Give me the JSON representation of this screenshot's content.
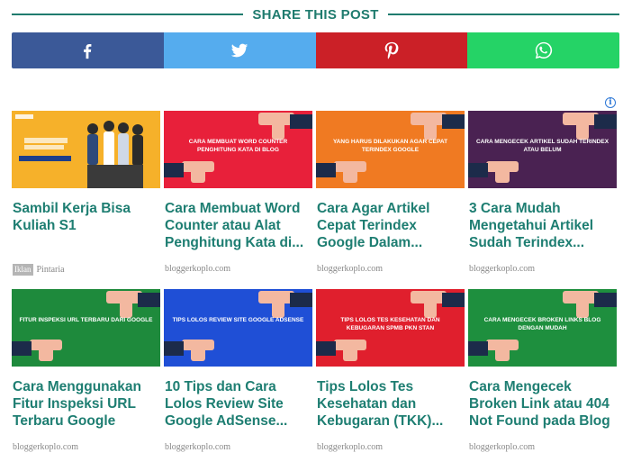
{
  "share": {
    "title": "SHARE THIS POST",
    "buttons": [
      {
        "name": "facebook",
        "icon": "facebook-icon",
        "color": "#3b5998"
      },
      {
        "name": "twitter",
        "icon": "twitter-icon",
        "color": "#55acee"
      },
      {
        "name": "pinterest",
        "icon": "pinterest-icon",
        "color": "#cb2027"
      },
      {
        "name": "whatsapp",
        "icon": "whatsapp-icon",
        "color": "#25d366"
      }
    ]
  },
  "ad_info_icon": "info-icon",
  "cards": [
    {
      "title": "Sambil Kerja Bisa Kuliah S1",
      "source": "Pintaria",
      "ad_label": "Iklan",
      "thumb_bg": "#f3a51f",
      "thumb_text": ""
    },
    {
      "title": "Cara Membuat Word Counter atau Alat Penghitung Kata di...",
      "source": "bloggerkoplo.com",
      "thumb_bg": "#e8203a",
      "thumb_text": "CARA MEMBUAT WORD COUNTER PENGHITUNG KATA DI BLOG"
    },
    {
      "title": "Cara Agar Artikel Cepat Terindex Google Dalam...",
      "source": "bloggerkoplo.com",
      "thumb_bg": "#f07a22",
      "thumb_text": "YANG HARUS DILAKUKAN AGAR CEPAT TERINDEX GOOGLE"
    },
    {
      "title": "3 Cara Mudah Mengetahui Artikel Sudah Terindex...",
      "source": "bloggerkoplo.com",
      "thumb_bg": "#4a2252",
      "thumb_text": "CARA MENGECEK ARTIKEL SUDAH TERINDEX ATAU BELUM"
    },
    {
      "title": "Cara Menggunakan Fitur Inspeksi URL Terbaru Google",
      "source": "bloggerkoplo.com",
      "thumb_bg": "#1e8a3c",
      "thumb_text": "FITUR INSPEKSI URL TERBARU DARI GOOGLE"
    },
    {
      "title": "10 Tips dan Cara Lolos Review Site Google AdSense...",
      "source": "bloggerkoplo.com",
      "thumb_bg": "#1f4fd6",
      "thumb_text": "TIPS LOLOS REVIEW SITE GOOGLE ADSENSE"
    },
    {
      "title": "Tips Lolos Tes Kesehatan dan Kebugaran (TKK)...",
      "source": "bloggerkoplo.com",
      "thumb_bg": "#e01f2d",
      "thumb_text": "TIPS LOLOS TES KESEHATAN DAN KEBUGARAN SPMB PKN STAN"
    },
    {
      "title": "Cara Mengecek Broken Link atau 404 Not Found pada Blog",
      "source": "bloggerkoplo.com",
      "thumb_bg": "#1e8f3e",
      "thumb_text": "CARA MENGECEK BROKEN LINKS BLOG DENGAN MUDAH"
    }
  ]
}
